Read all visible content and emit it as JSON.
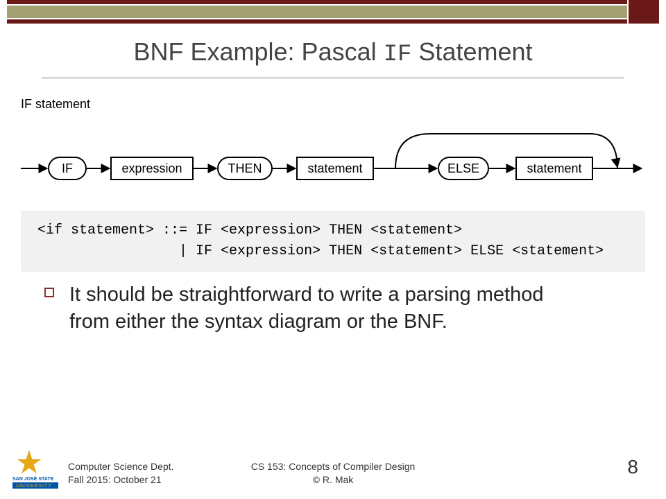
{
  "title": {
    "pre": "BNF Example: Pascal ",
    "kw": "IF",
    "post": " Statement"
  },
  "diagram": {
    "label": "IF statement",
    "nodes": {
      "if": "IF",
      "expr": "expression",
      "then": "THEN",
      "stmt1": "statement",
      "else": "ELSE",
      "stmt2": "statement"
    }
  },
  "bnf": {
    "line1": " <if statement> ::= IF <expression> THEN <statement>",
    "line2": "                  | IF <expression> THEN <statement> ELSE <statement>"
  },
  "bullet": {
    "text": "It should be straightforward to write a parsing method from either the syntax diagram or the BNF."
  },
  "footer": {
    "dept": "Computer Science Dept.",
    "term": "Fall 2015: October 21",
    "course": "CS 153: Concepts of Compiler Design",
    "copyright": "© R. Mak",
    "page": "8",
    "logo": {
      "name": "San José State University"
    }
  }
}
